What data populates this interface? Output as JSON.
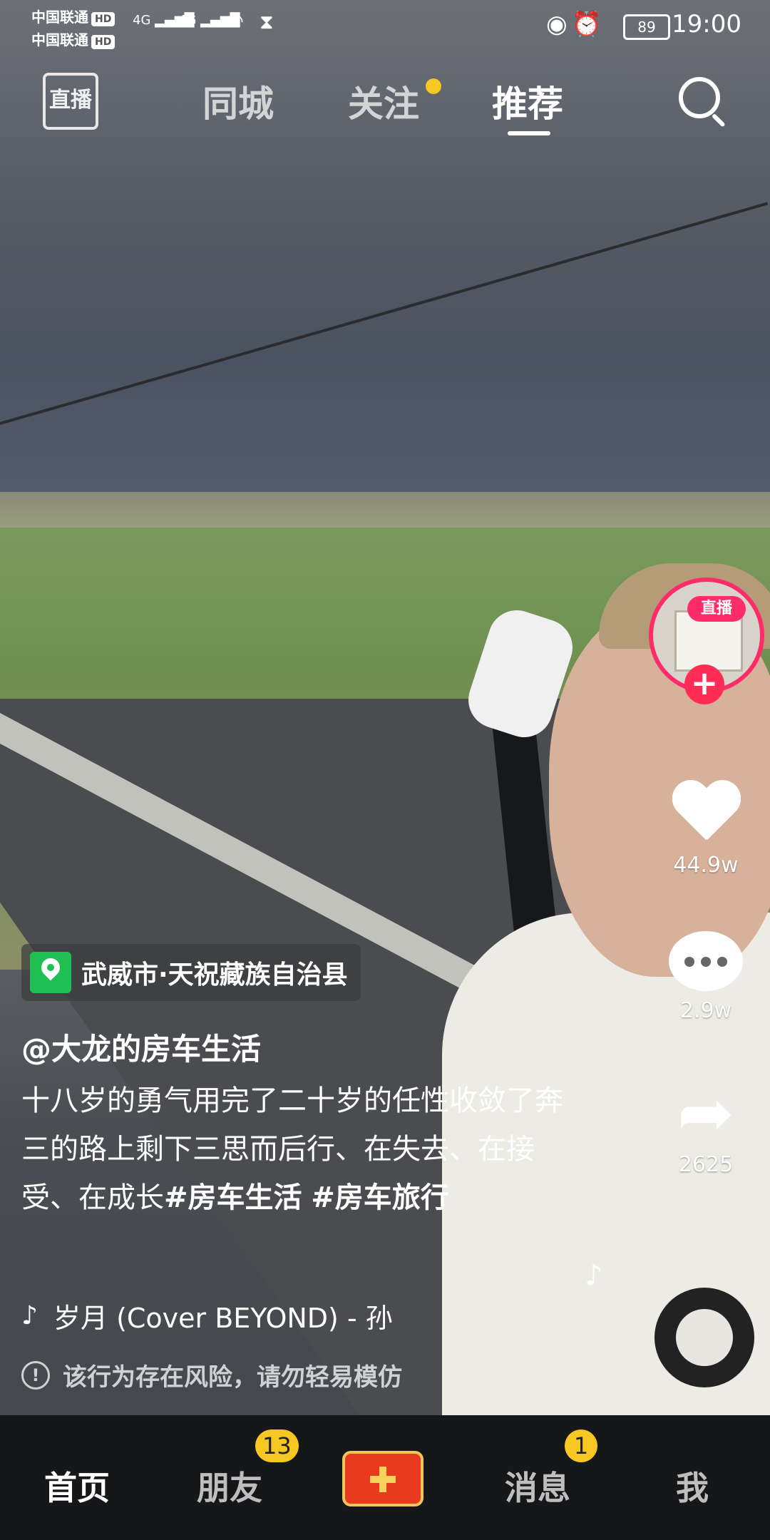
{
  "status_bar": {
    "carrier1": "中国联通",
    "carrier2": "中国联通",
    "hd_label": "HD",
    "network1": "4G",
    "network2": "4G",
    "battery": "89",
    "time": "19:00"
  },
  "top_nav": {
    "live_label": "直播",
    "tabs": [
      {
        "label": "同城"
      },
      {
        "label": "关注"
      },
      {
        "label": "推荐"
      }
    ],
    "active_tab": "推荐"
  },
  "right_rail": {
    "live_badge": "直播",
    "follow_label": "+",
    "likes": "44.9w",
    "comments": "2.9w",
    "shares": "2625"
  },
  "post": {
    "location": "武威市·天祝藏族自治县",
    "author": "@大龙的房车生活",
    "description_plain": "十八岁的勇气用完了二十岁的任性收敛了奔三的路上剩下三思而后行、在失去、在接受、在成长",
    "hashtag1": "#房车生活",
    "hashtag2": "#房车旅行",
    "music": "岁月 (Cover BEYOND) - 孙",
    "warning": "该行为存在风险，请勿轻易模仿"
  },
  "bottom_nav": {
    "home": "首页",
    "friends": "朋友",
    "friends_badge": "13",
    "messages": "消息",
    "messages_badge": "1",
    "me": "我"
  },
  "colors": {
    "accent_pink": "#ff2c55",
    "badge_yellow": "#f6c623",
    "location_green": "#1fbf54"
  }
}
